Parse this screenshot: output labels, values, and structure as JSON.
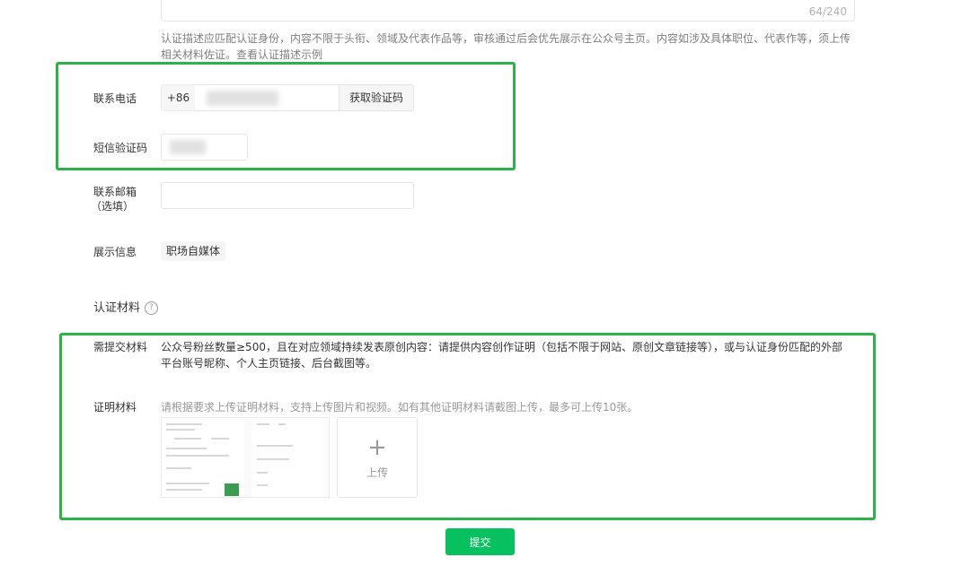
{
  "description": {
    "counter": "64/240",
    "text": "认证描述应匹配认证身份，内容不限于头衔、领域及代表作品等，审核通过后会优先展示在公众号主页。内容如涉及具体职位、代表作等，须上传相关材料佐证。",
    "link": "查看认证描述示例"
  },
  "phone": {
    "label": "联系电话",
    "prefix": "+86",
    "button": "获取验证码"
  },
  "sms": {
    "label": "短信验证码"
  },
  "email": {
    "label_line1": "联系邮箱",
    "label_line2": "（选填）"
  },
  "display_info": {
    "label": "展示信息",
    "value": "职场自媒体"
  },
  "materials": {
    "section_title": "认证材料",
    "help_icon": "?",
    "required_label": "需提交材料",
    "required_text": "公众号粉丝数量≥500，且在对应领域持续发表原创内容：请提供内容创作证明（包括不限于网站、原创文章链接等），或与认证身份匹配的外部平台账号昵称、个人主页链接、后台截图等。",
    "proof_label": "证明材料",
    "proof_hint": "请根据要求上传证明材料，支持上传图片和视频。如有其他证明材料请截图上传，最多可上传10张。",
    "upload_plus": "+",
    "upload_label": "上传"
  },
  "submit": {
    "label": "提交"
  },
  "colors": {
    "accent": "#07c160",
    "highlight": "#2bb34a"
  }
}
